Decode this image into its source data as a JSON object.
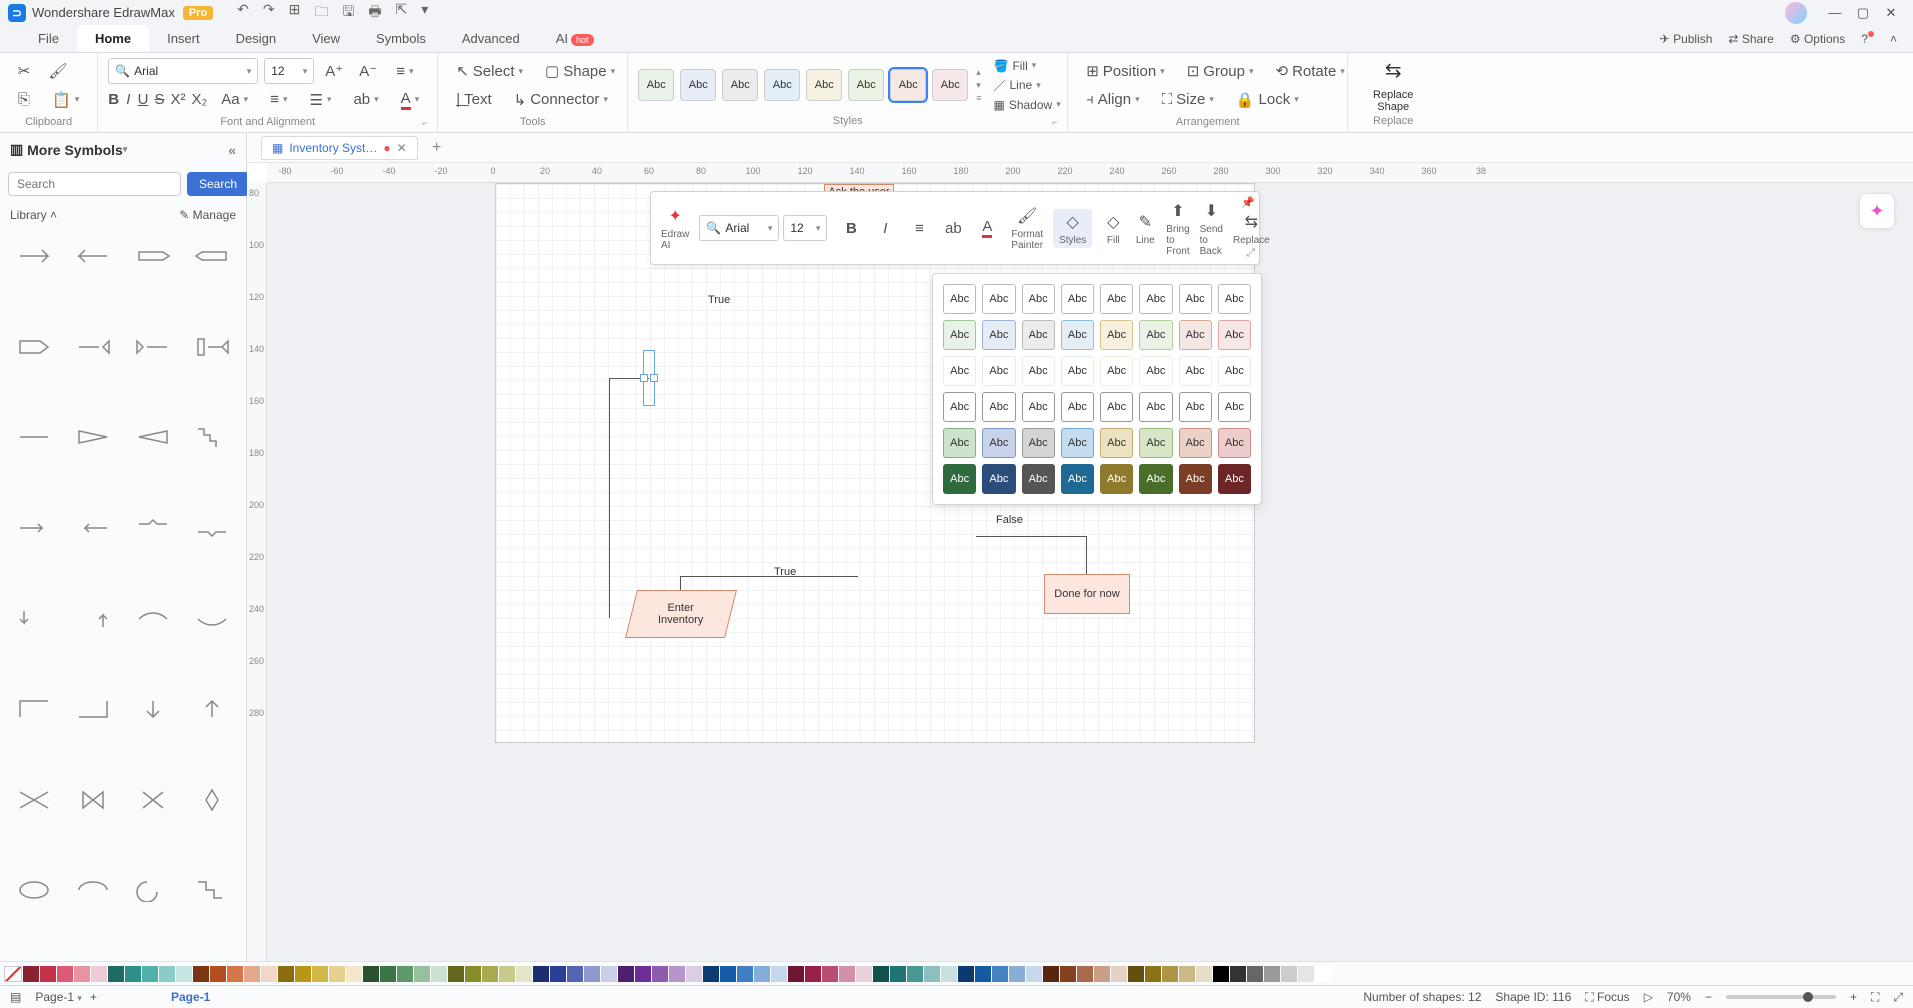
{
  "app": {
    "title": "Wondershare EdrawMax",
    "pro_badge": "Pro"
  },
  "quick_access": [
    "undo-icon",
    "redo-icon",
    "new-icon",
    "open-icon",
    "save-icon",
    "print-icon",
    "export-icon",
    "more-icon"
  ],
  "window_controls": {
    "min": "—",
    "max": "▢",
    "close": "✕"
  },
  "menubar": {
    "tabs": [
      "File",
      "Home",
      "Insert",
      "Design",
      "View",
      "Symbols",
      "Advanced",
      "AI"
    ],
    "active": "Home",
    "ai_hot": "hot",
    "right": {
      "publish": "Publish",
      "share": "Share",
      "options": "Options"
    }
  },
  "ribbon": {
    "clipboard": {
      "label": "Clipboard"
    },
    "font": {
      "label": "Font and Alignment",
      "name": "Arial",
      "size": "12"
    },
    "tools": {
      "label": "Tools",
      "select": "Select",
      "shape": "Shape",
      "text": "Text",
      "connector": "Connector"
    },
    "styles": {
      "label": "Styles",
      "swatches": [
        "Abc",
        "Abc",
        "Abc",
        "Abc",
        "Abc",
        "Abc",
        "Abc",
        "Abc"
      ],
      "fill": "Fill",
      "line": "Line",
      "shadow": "Shadow"
    },
    "arrangement": {
      "label": "Arrangement",
      "position": "Position",
      "group": "Group",
      "rotate": "Rotate",
      "align": "Align",
      "size": "Size",
      "lock": "Lock"
    },
    "replace": {
      "label": "Replace",
      "replace_shape": "Replace\nShape"
    }
  },
  "left_panel": {
    "title": "More Symbols",
    "search_placeholder": "Search",
    "search_btn": "Search",
    "library": "Library",
    "manage": "Manage"
  },
  "doc_tabs": {
    "active": "Inventory Syst…"
  },
  "ruler_h": [
    "-80",
    "-60",
    "-40",
    "-20",
    "0",
    "20",
    "40",
    "60",
    "80",
    "100",
    "120",
    "140",
    "160",
    "180",
    "200",
    "220",
    "240",
    "260",
    "280",
    "300",
    "320",
    "340",
    "360",
    "38"
  ],
  "ruler_v": [
    "80",
    "100",
    "120",
    "140",
    "160",
    "180",
    "200",
    "220",
    "240",
    "260",
    "280"
  ],
  "mini_toolbar": {
    "edraw_ai": "Edraw AI",
    "font_name": "Arial",
    "font_size": "12",
    "format_painter": "Format\nPainter",
    "styles": "Styles",
    "fill": "Fill",
    "line": "Line",
    "bring_to_front": "Bring to Front",
    "send_to_back": "Send to Back",
    "replace": "Replace"
  },
  "canvas_shapes": {
    "ask_user": "Ask the user\nfor amount in\nstock",
    "enter_inventory": "Enter\nInventory",
    "done_for_now": "Done for now",
    "true1": "True",
    "true2": "True",
    "false": "False"
  },
  "styles_popup": {
    "rows": 6,
    "cols": 8,
    "cell_text": "Abc",
    "row_colors": [
      [
        [
          "#fff",
          "#bbb"
        ],
        [
          "#fff",
          "#bbb"
        ],
        [
          "#fff",
          "#bbb"
        ],
        [
          "#fff",
          "#bbb"
        ],
        [
          "#fff",
          "#bbb"
        ],
        [
          "#fff",
          "#bbb"
        ],
        [
          "#fff",
          "#bbb"
        ],
        [
          "#fff",
          "#bbb"
        ]
      ],
      [
        [
          "#e9f2e9",
          "#9fc79f"
        ],
        [
          "#e5ecf5",
          "#9fb4d6"
        ],
        [
          "#ececec",
          "#bbb"
        ],
        [
          "#e3eef7",
          "#8fbde0"
        ],
        [
          "#f7f0df",
          "#d6c38e"
        ],
        [
          "#e9f2e4",
          "#b3ce9c"
        ],
        [
          "#f5e8e4",
          "#d6a995"
        ],
        [
          "#f7e7e7",
          "#dba7a7"
        ]
      ],
      [
        [
          "#fff",
          "#e5efe5"
        ],
        [
          "#fff",
          "#e3e9f2"
        ],
        [
          "#fff",
          "#ececec"
        ],
        [
          "#fff",
          "#e1edf6"
        ],
        [
          "#fff",
          "#f5efe0"
        ],
        [
          "#fff",
          "#eaf2e4"
        ],
        [
          "#fff",
          "#f3e8e4"
        ],
        [
          "#fff",
          "#f5e7e7"
        ]
      ],
      [
        [
          "#fff",
          "#999"
        ],
        [
          "#fff",
          "#999"
        ],
        [
          "#fff",
          "#999"
        ],
        [
          "#fff",
          "#999"
        ],
        [
          "#fff",
          "#999"
        ],
        [
          "#fff",
          "#999"
        ],
        [
          "#fff",
          "#999"
        ],
        [
          "#fff",
          "#999"
        ]
      ],
      [
        [
          "#cde3cd",
          "#7fb27f"
        ],
        [
          "#c7d3e8",
          "#7f95c4"
        ],
        [
          "#d4d4d4",
          "#999"
        ],
        [
          "#c3dcef",
          "#6fa9d1"
        ],
        [
          "#ece1c0",
          "#c4ad72"
        ],
        [
          "#d6e6c7",
          "#9cbd7d"
        ],
        [
          "#ebd2c7",
          "#c79179"
        ],
        [
          "#edcccc",
          "#ce8a8a"
        ]
      ],
      [
        [
          "#2e6a3e",
          "#2e6a3e"
        ],
        [
          "#2c4d7a",
          "#2c4d7a"
        ],
        [
          "#555",
          "#555"
        ],
        [
          "#1f6a94",
          "#1f6a94"
        ],
        [
          "#8e7a2c",
          "#8e7a2c"
        ],
        [
          "#4a6e2a",
          "#4a6e2a"
        ],
        [
          "#7a3e27",
          "#7a3e27"
        ],
        [
          "#6d2525",
          "#6d2525"
        ]
      ]
    ]
  },
  "color_bar": [
    "#8b2231",
    "#c23248",
    "#db5a75",
    "#e793a4",
    "#f1cbd3",
    "#1e6a64",
    "#2e9088",
    "#4fb1a9",
    "#8cccc6",
    "#c7e6e3",
    "#7a3515",
    "#b34e20",
    "#d5764a",
    "#e4a88a",
    "#f2d6c8",
    "#8a6d0e",
    "#bb9516",
    "#d5b648",
    "#e5d18d",
    "#f3e9c9",
    "#285230",
    "#3a7545",
    "#5e9a67",
    "#97c09e",
    "#cde1d1",
    "#63661c",
    "#878b29",
    "#a7ab4f",
    "#c7ca8c",
    "#e4e5c8",
    "#1d2c6e",
    "#2c3f97",
    "#5565b4",
    "#9099cf",
    "#cacfe8",
    "#4e1f6f",
    "#6c2d96",
    "#8f5ab0",
    "#b695cc",
    "#dccde6",
    "#0e3a72",
    "#175aa6",
    "#4080c2",
    "#84add8",
    "#c4d8ec",
    "#6e1530",
    "#9a2046",
    "#b84f72",
    "#d291a7",
    "#ead0d9",
    "#135150",
    "#1d7472",
    "#479996",
    "#8bc0be",
    "#c8e0df",
    "#0b3a6e",
    "#155aa0",
    "#4582bf",
    "#88add7",
    "#c6d8eb",
    "#5a2510",
    "#854020",
    "#a86a4b",
    "#c99f87",
    "#e5d1c6",
    "#654f0c",
    "#8f7115",
    "#b09445",
    "#ccb987",
    "#e7ddc6",
    "#000",
    "#333",
    "#666",
    "#999",
    "#ccc",
    "#e5e5e5",
    "#fff"
  ],
  "statusbar": {
    "page_label": "Page-1",
    "page_name": "Page-1",
    "num_shapes_label": "Number of shapes:",
    "num_shapes": "12",
    "shape_id_label": "Shape ID:",
    "shape_id": "116",
    "focus": "Focus",
    "zoom": "70%"
  }
}
